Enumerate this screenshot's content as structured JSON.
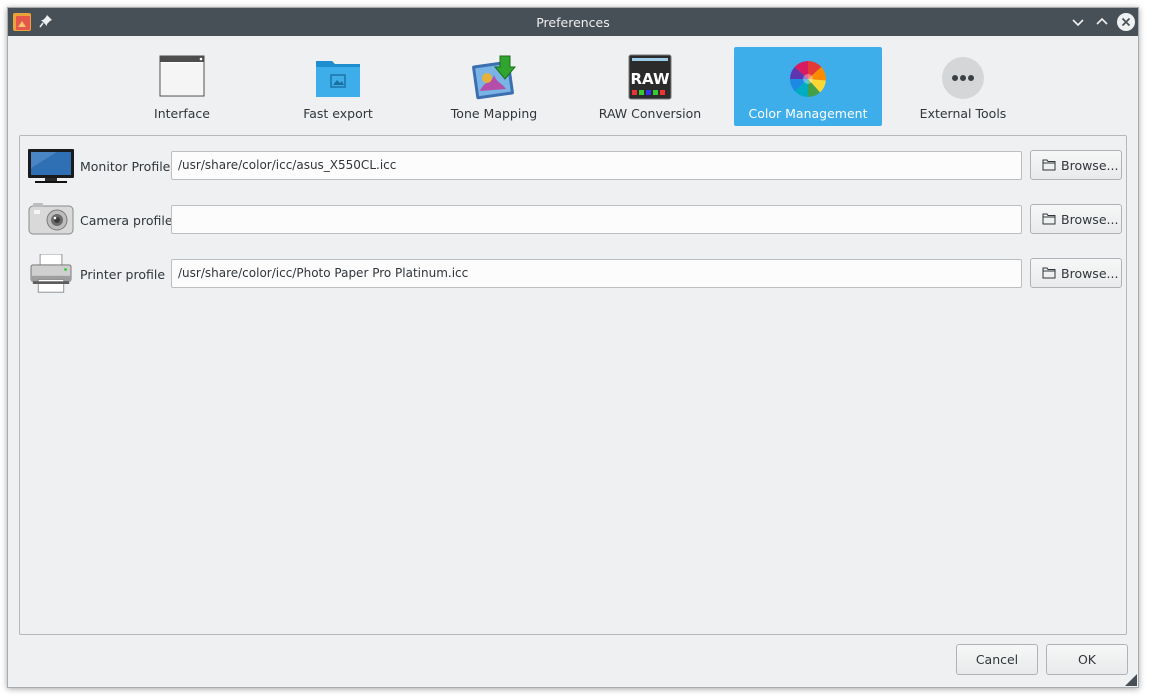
{
  "window": {
    "title": "Preferences"
  },
  "pages": [
    {
      "label": "Interface",
      "icon": "window-icon",
      "active": false
    },
    {
      "label": "Fast export",
      "icon": "folder-image-icon",
      "active": false
    },
    {
      "label": "Tone Mapping",
      "icon": "tone-mapping-icon",
      "active": false
    },
    {
      "label": "RAW Conversion",
      "icon": "raw-icon",
      "active": false
    },
    {
      "label": "Color Management",
      "icon": "color-wheel-icon",
      "active": true
    },
    {
      "label": "External Tools",
      "icon": "more-dots-icon",
      "active": false
    }
  ],
  "raw_icon_text": "RAW",
  "profiles": {
    "monitor": {
      "label": "Monitor Profile",
      "value": "/usr/share/color/icc/asus_X550CL.icc",
      "browse": "Browse...",
      "icon": "monitor-icon"
    },
    "camera": {
      "label": "Camera profile",
      "value": "",
      "browse": "Browse...",
      "icon": "camera-icon"
    },
    "printer": {
      "label": "Printer profile",
      "value": "/usr/share/color/icc/Photo Paper Pro Platinum.icc",
      "browse": "Browse...",
      "icon": "printer-icon"
    }
  },
  "footer": {
    "cancel": "Cancel",
    "ok": "OK"
  },
  "colors": {
    "titlebar": "#475057",
    "accent": "#3daee9",
    "window_bg": "#eff0f1"
  }
}
